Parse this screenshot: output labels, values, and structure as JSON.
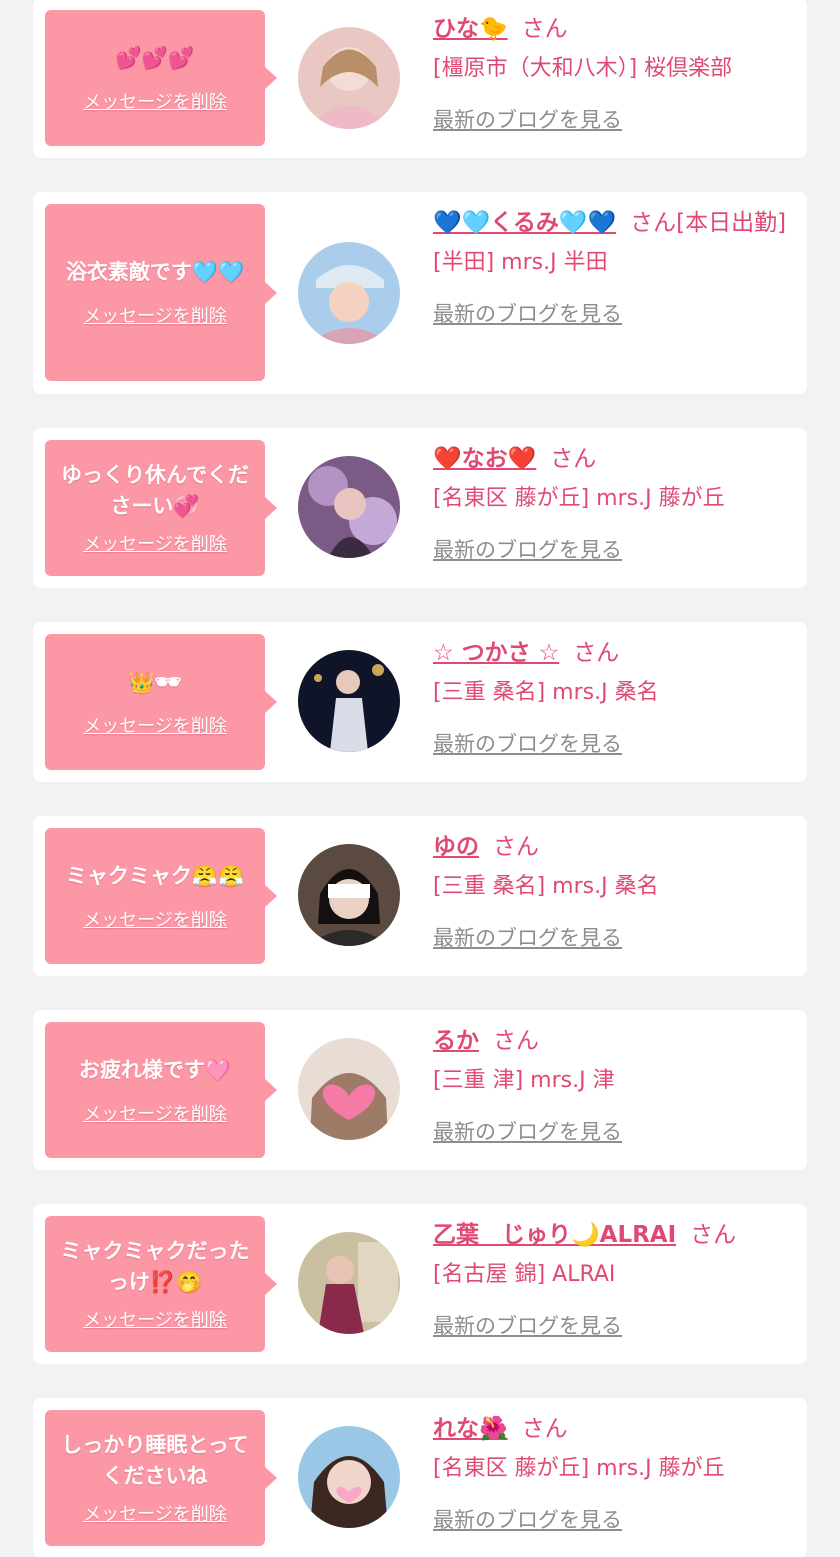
{
  "ui": {
    "delete_label": "メッセージを削除",
    "blog_label": "最新のブログを見る",
    "honorific": "さん"
  },
  "colors": {
    "background": "#f2f2f2",
    "bubble": "#fc97a6",
    "accent": "#e04a72",
    "link_gray": "#8d8d8d"
  },
  "entries": [
    {
      "message": "💕💕💕",
      "name": "ひな🐤",
      "shop": "[橿原市（大和八木）] 桜倶楽部",
      "avatar_icon": "avatar-photo-icon"
    },
    {
      "message": "浴衣素敵です🩵🩵",
      "name": "💙🩵くるみ🩵💙",
      "shop": "[本日出勤]",
      "shop2": "[半田] mrs.J 半田",
      "avatar_icon": "avatar-photo-icon"
    },
    {
      "message": "ゆっくり休んでくださーい💞",
      "name": "❤️なお❤️",
      "shop": "[名東区 藤が丘] mrs.J 藤が丘",
      "avatar_icon": "avatar-photo-icon"
    },
    {
      "message": "👑🕶",
      "name": "☆ つかさ ☆",
      "shop": "[三重 桑名] mrs.J 桑名",
      "avatar_icon": "avatar-photo-icon"
    },
    {
      "message": "ミャクミャク😤😤",
      "name": "ゆの",
      "shop": "[三重 桑名] mrs.J 桑名",
      "avatar_icon": "avatar-photo-icon"
    },
    {
      "message": "お疲れ様です🩷",
      "name": "るか",
      "shop": "[三重 津] mrs.J 津",
      "avatar_icon": "avatar-photo-icon"
    },
    {
      "message": "ミャクミャクだったっけ⁉️🤭",
      "name": "乙葉　じゅり🌙ALRAI",
      "shop": "[名古屋 錦] ALRAI",
      "avatar_icon": "avatar-photo-icon"
    },
    {
      "message": "しっかり睡眠とってくださいね",
      "name": "れな🌺",
      "shop": "[名東区 藤が丘] mrs.J 藤が丘",
      "avatar_icon": "avatar-photo-icon"
    }
  ]
}
